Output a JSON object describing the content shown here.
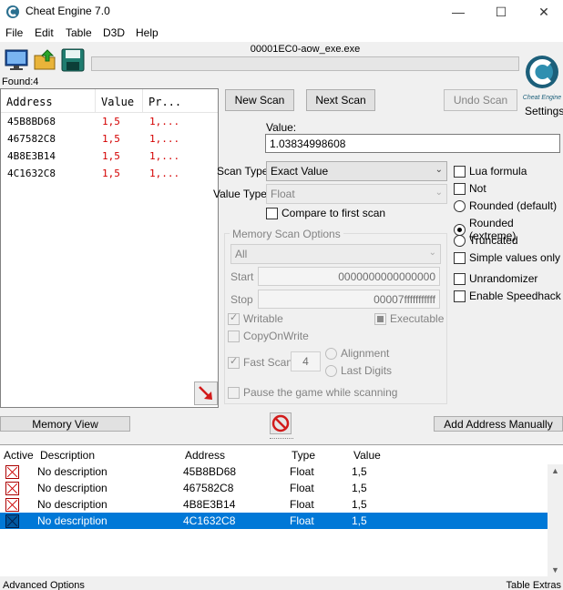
{
  "window": {
    "title": "Cheat Engine 7.0",
    "minimize": "—",
    "maximize": "☐",
    "close": "✕"
  },
  "menu": [
    "File",
    "Edit",
    "Table",
    "D3D",
    "Help"
  ],
  "toolbar": {
    "process_name": "00001EC0-aow_exe.exe",
    "progress": 0
  },
  "found": "Found:4",
  "results": {
    "columns": [
      "Address",
      "Value",
      "Pr..."
    ],
    "rows": [
      {
        "address": "45B8BD68",
        "value": "1,5",
        "previous": "1,..."
      },
      {
        "address": "467582C8",
        "value": "1,5",
        "previous": "1,..."
      },
      {
        "address": "4B8E3B14",
        "value": "1,5",
        "previous": "1,..."
      },
      {
        "address": "4C1632C8",
        "value": "1,5",
        "previous": "1,..."
      }
    ]
  },
  "scan": {
    "new_scan": "New Scan",
    "next_scan": "Next Scan",
    "undo_scan": "Undo Scan",
    "settings": "Settings",
    "logo_text": "Cheat Engine",
    "value_label": "Value:",
    "value": "1.03834998608",
    "scan_type_label": "Scan Type",
    "scan_type": "Exact Value",
    "value_type_label": "Value Type",
    "value_type": "Float",
    "compare_first": "Compare to first scan"
  },
  "memory_options": {
    "title": "Memory Scan Options",
    "region": "All",
    "start_label": "Start",
    "start": "0000000000000000",
    "stop_label": "Stop",
    "stop": "00007fffffffffff",
    "writable": "Writable",
    "executable": "Executable",
    "copy_on_write": "CopyOnWrite",
    "fast_scan": "Fast Scan",
    "fast_scan_value": "4",
    "alignment": "Alignment",
    "last_digits": "Last Digits",
    "pause": "Pause the game while scanning"
  },
  "right_options": {
    "lua_formula": "Lua formula",
    "not": "Not",
    "rounded_default": "Rounded (default)",
    "rounded_extreme": "Rounded (extreme)",
    "truncated": "Truncated",
    "simple_values": "Simple values only",
    "unrandomizer": "Unrandomizer",
    "speedhack": "Enable Speedhack"
  },
  "bottom_buttons": {
    "memory_view": "Memory View",
    "add_address": "Add Address Manually"
  },
  "address_list": {
    "columns": [
      "Active",
      "Description",
      "Address",
      "Type",
      "Value"
    ],
    "rows": [
      {
        "description": "No description",
        "address": "45B8BD68",
        "type": "Float",
        "value": "1,5"
      },
      {
        "description": "No description",
        "address": "467582C8",
        "type": "Float",
        "value": "1,5"
      },
      {
        "description": "No description",
        "address": "4B8E3B14",
        "type": "Float",
        "value": "1,5"
      },
      {
        "description": "No description",
        "address": "4C1632C8",
        "type": "Float",
        "value": "1,5"
      }
    ]
  },
  "status": {
    "advanced": "Advanced Options",
    "table_extras": "Table Extras"
  }
}
